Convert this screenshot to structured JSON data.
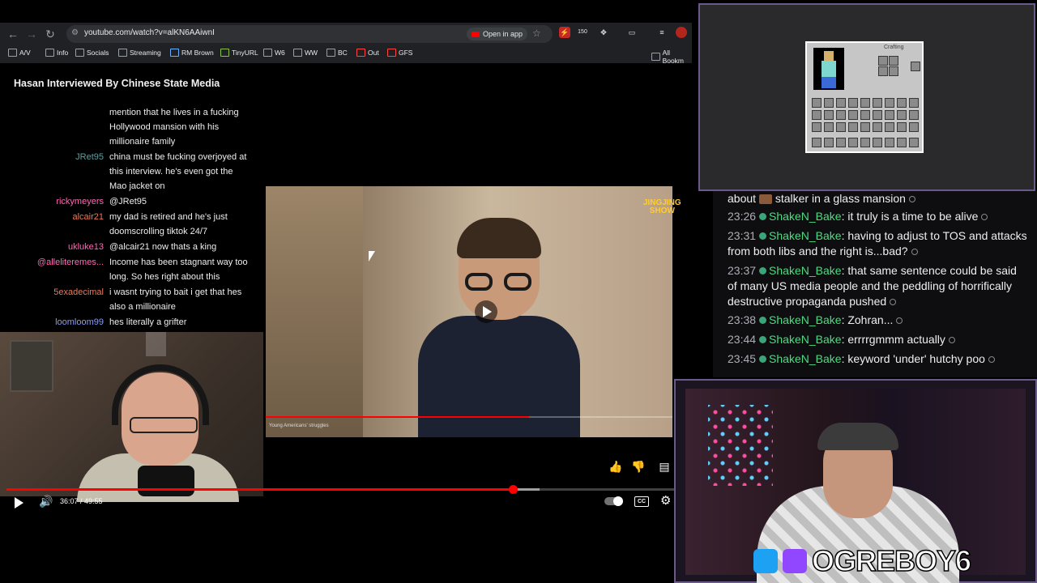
{
  "browser": {
    "url": "youtube.com/watch?v=alKN6AAiwnI",
    "open_in_app": "Open in app",
    "ext_badge": "150",
    "bookmarks": [
      "A/V",
      "Info",
      "Socials",
      "Streaming",
      "RM Brown",
      "TinyURL",
      "W6",
      "WW",
      "BC",
      "Out",
      "GFS",
      "All Bookm"
    ]
  },
  "video": {
    "title": "Hasan Interviewed By Chinese State Media",
    "time": "36:07 / 49:55",
    "progress_fraction": 0.724,
    "embed_logo_line1": "JINGJING",
    "embed_logo_line2": "SHOW",
    "embed_caption": "Young Americans' struggles"
  },
  "left_chat": [
    {
      "name": "",
      "color": "#efeff1",
      "lines": [
        "mention that he lives in a fucking",
        "Hollywood mansion with his",
        "millionaire family"
      ]
    },
    {
      "name": "JRet95",
      "color": "#5ba0a0",
      "lines": [
        "china must be fucking overjoyed at",
        "this interview. he's even got the",
        "Mao jacket on"
      ]
    },
    {
      "name": "rickymeyers",
      "color": "#ff69b4",
      "lines": [
        "@JRet95"
      ]
    },
    {
      "name": "alcair21",
      "color": "#e87b5c",
      "lines": [
        "my dad is retired and he's just",
        "doomscrolling tiktok 24/7"
      ]
    },
    {
      "name": "ukluke13",
      "color": "#ff69b4",
      "lines": [
        "@alcair21 now thats a king"
      ]
    },
    {
      "name": "@alleliteremes...",
      "color": "#ff69b4",
      "lines": [
        "Income has been stagnant way too",
        "long. So hes right about this"
      ]
    },
    {
      "name": "5exadecimal",
      "color": "#e87b5c",
      "lines": [
        "i wasnt trying to bait i get that hes",
        "also a millionaire"
      ]
    },
    {
      "name": "loomloom99",
      "color": "#8a9cff",
      "lines": [
        "hes literally a grifter"
      ]
    }
  ],
  "minecraft": {
    "crafting_label": "Crafting"
  },
  "right_chat": [
    {
      "ts": "",
      "name": "",
      "pre": "about",
      "msg": "stalker in a glass mansion"
    },
    {
      "ts": "23:26",
      "name": "ShakeN_Bake",
      "msg": "it truly is a time to be alive"
    },
    {
      "ts": "23:31",
      "name": "ShakeN_Bake",
      "msg": "having to adjust to TOS and attacks from both libs and the right is...bad?"
    },
    {
      "ts": "23:37",
      "name": "ShakeN_Bake",
      "msg": "that same sentence could be said of many US media people and the peddling of horrifically destructive propaganda pushed"
    },
    {
      "ts": "23:38",
      "name": "ShakeN_Bake",
      "msg": "Zohran..."
    },
    {
      "ts": "23:44",
      "name": "ShakeN_Bake",
      "msg": "errrrgmmm actually"
    },
    {
      "ts": "23:45",
      "name": "ShakeN_Bake",
      "msg": "keyword 'under' hutchy poo"
    }
  ],
  "overlay": {
    "channel_name": "OGREBOY6"
  }
}
